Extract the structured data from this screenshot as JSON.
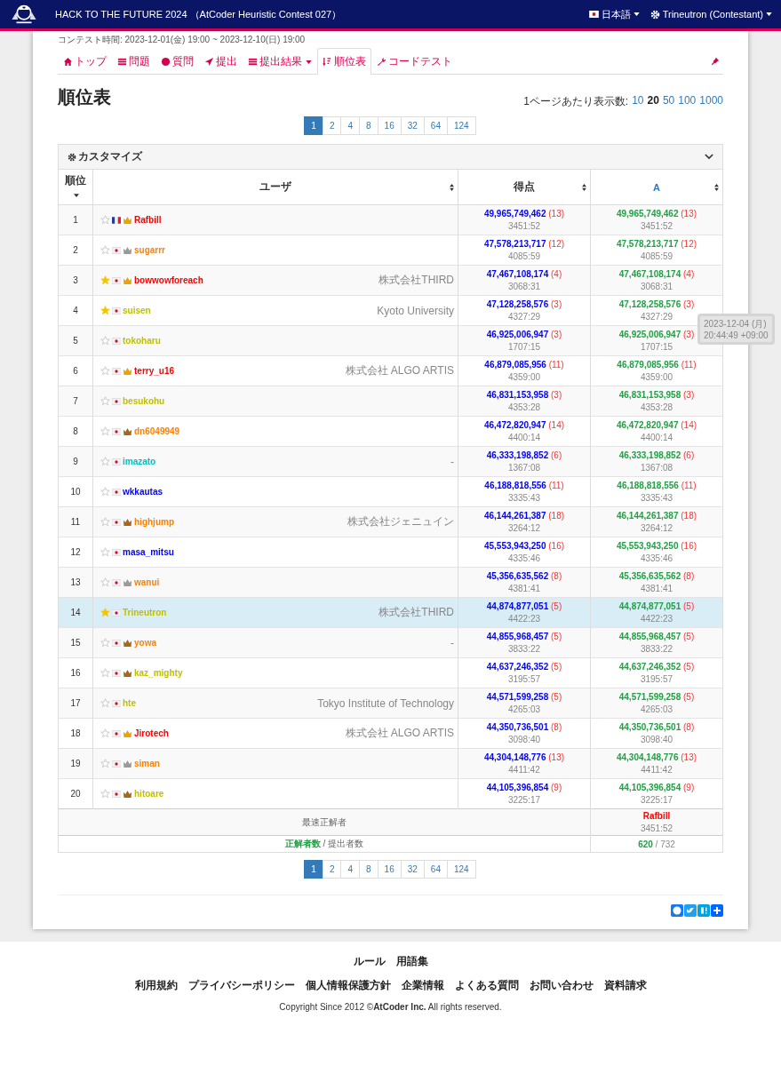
{
  "header": {
    "title": "HACK TO THE FUTURE 2024 （AtCoder Heuristic Contest 027）",
    "language": "日本語",
    "user": "Trineutron (Contestant)"
  },
  "contest_period": "コンテスト時間: 2023-12-01(金) 19:00 ~ 2023-12-10(日) 19:00",
  "tabs": [
    {
      "label": "トップ",
      "selected": false,
      "dropdown": false
    },
    {
      "label": "問題",
      "selected": false,
      "dropdown": false
    },
    {
      "label": "質問",
      "selected": false,
      "dropdown": false
    },
    {
      "label": "提出",
      "selected": false,
      "dropdown": false
    },
    {
      "label": "提出結果",
      "selected": false,
      "dropdown": true
    },
    {
      "label": "順位表",
      "selected": true,
      "dropdown": false
    },
    {
      "label": "コードテスト",
      "selected": false,
      "dropdown": false
    }
  ],
  "page_title": "順位表",
  "per_page": {
    "label": "1ページあたり表示数:",
    "options": [
      {
        "label": "10",
        "selected": false
      },
      {
        "label": "20",
        "selected": true
      },
      {
        "label": "50",
        "selected": false
      },
      {
        "label": "100",
        "selected": false
      },
      {
        "label": "1000",
        "selected": false
      }
    ]
  },
  "pagination_top": [
    {
      "label": "1",
      "selected": true
    },
    {
      "label": "2",
      "selected": false
    },
    {
      "label": "4",
      "selected": false
    },
    {
      "label": "8",
      "selected": false
    },
    {
      "label": "16",
      "selected": false
    },
    {
      "label": "32",
      "selected": false
    },
    {
      "label": "64",
      "selected": false
    },
    {
      "label": "124",
      "selected": false
    }
  ],
  "customize": "カスタマイズ",
  "columns": [
    "順位",
    "ユーザ",
    "得点",
    "A"
  ],
  "rows": [
    {
      "rank": "1",
      "favorite": false,
      "flag": {
        "kind": "fr"
      },
      "crown": {
        "kind": "gold"
      },
      "user": "Rafbill",
      "color": "#ff0000",
      "affiliation": "",
      "score": "49,965,749,462",
      "penalty": "(13)",
      "time": "3451:52",
      "a_score": "49,965,749,462",
      "a_penalty": "(13)",
      "a_time": "3451:52",
      "highlighted": false
    },
    {
      "rank": "2",
      "favorite": false,
      "flag": {
        "kind": "jp"
      },
      "crown": {
        "kind": "silver"
      },
      "user": "sugarrr",
      "color": "#ff8000",
      "affiliation": "",
      "score": "47,578,213,717",
      "penalty": "(12)",
      "time": "4085:59",
      "a_score": "47,578,213,717",
      "a_penalty": "(12)",
      "a_time": "4085:59",
      "highlighted": false
    },
    {
      "rank": "3",
      "favorite": true,
      "flag": {
        "kind": "jp"
      },
      "crown": {
        "kind": "gold"
      },
      "user": "bowwowforeach",
      "color": "#ff0000",
      "affiliation": "株式会社THIRD",
      "score": "47,467,108,174",
      "penalty": "(4)",
      "time": "3068:31",
      "a_score": "47,467,108,174",
      "a_penalty": "(4)",
      "a_time": "3068:31",
      "highlighted": false
    },
    {
      "rank": "4",
      "favorite": true,
      "flag": {
        "kind": "jp"
      },
      "user": "suisen",
      "color": "#c0c000",
      "affiliation": "Kyoto University",
      "score": "47,128,258,576",
      "penalty": "(3)",
      "time": "4327:29",
      "a_score": "47,128,258,576",
      "a_penalty": "(3)",
      "a_time": "4327:29",
      "highlighted": false
    },
    {
      "rank": "5",
      "favorite": false,
      "flag": {
        "kind": "jp"
      },
      "user": "tokoharu",
      "color": "#c0c000",
      "affiliation": "",
      "score": "46,925,006,947",
      "penalty": "(3)",
      "time": "1707:15",
      "a_score": "46,925,006,947",
      "a_penalty": "(3)",
      "a_time": "1707:15",
      "highlighted": false
    },
    {
      "rank": "6",
      "favorite": false,
      "flag": {
        "kind": "jp"
      },
      "crown": {
        "kind": "gold"
      },
      "user": "terry_u16",
      "color": "#ff0000",
      "affiliation": "株式会社 ALGO ARTIS",
      "score": "46,879,085,956",
      "penalty": "(11)",
      "time": "4359:00",
      "a_score": "46,879,085,956",
      "a_penalty": "(11)",
      "a_time": "4359:00",
      "highlighted": false
    },
    {
      "rank": "7",
      "favorite": false,
      "flag": {
        "kind": "jp"
      },
      "user": "besukohu",
      "color": "#c0c000",
      "affiliation": "",
      "score": "46,831,153,958",
      "penalty": "(3)",
      "time": "4353:28",
      "a_score": "46,831,153,958",
      "a_penalty": "(3)",
      "a_time": "4353:28",
      "highlighted": false
    },
    {
      "rank": "8",
      "favorite": false,
      "flag": {
        "kind": "jp"
      },
      "crown": {
        "kind": "bronze"
      },
      "user": "dn6049949",
      "color": "#ff8000",
      "affiliation": "",
      "score": "46,472,820,947",
      "penalty": "(14)",
      "time": "4400:14",
      "a_score": "46,472,820,947",
      "a_penalty": "(14)",
      "a_time": "4400:14",
      "highlighted": false
    },
    {
      "rank": "9",
      "favorite": false,
      "flag": {
        "kind": "jp"
      },
      "user": "imazato",
      "color": "#00c0c0",
      "affiliation": "-",
      "score": "46,333,198,852",
      "penalty": "(6)",
      "time": "1367:08",
      "a_score": "46,333,198,852",
      "a_penalty": "(6)",
      "a_time": "1367:08",
      "highlighted": false
    },
    {
      "rank": "10",
      "favorite": false,
      "flag": {
        "kind": "jp"
      },
      "user": "wkkautas",
      "color": "#0000ff",
      "affiliation": "",
      "score": "46,188,818,556",
      "penalty": "(11)",
      "time": "3335:43",
      "a_score": "46,188,818,556",
      "a_penalty": "(11)",
      "a_time": "3335:43",
      "highlighted": false
    },
    {
      "rank": "11",
      "favorite": false,
      "flag": {
        "kind": "jp"
      },
      "crown": {
        "kind": "bronze"
      },
      "user": "highjump",
      "color": "#ff8000",
      "affiliation": "株式会社ジェニュイン",
      "score": "46,144,261,387",
      "penalty": "(18)",
      "time": "3264:12",
      "a_score": "46,144,261,387",
      "a_penalty": "(18)",
      "a_time": "3264:12",
      "highlighted": false
    },
    {
      "rank": "12",
      "favorite": false,
      "flag": {
        "kind": "jp"
      },
      "user": "masa_mitsu",
      "color": "#0000ff",
      "affiliation": "",
      "score": "45,553,943,250",
      "penalty": "(16)",
      "time": "4335:46",
      "a_score": "45,553,943,250",
      "a_penalty": "(16)",
      "a_time": "4335:46",
      "highlighted": false
    },
    {
      "rank": "13",
      "favorite": false,
      "flag": {
        "kind": "jp"
      },
      "crown": {
        "kind": "silver"
      },
      "user": "wanui",
      "color": "#ff8000",
      "affiliation": "",
      "score": "45,356,635,562",
      "penalty": "(8)",
      "time": "4381:41",
      "a_score": "45,356,635,562",
      "a_penalty": "(8)",
      "a_time": "4381:41",
      "highlighted": false
    },
    {
      "rank": "14",
      "favorite": true,
      "flag": {
        "kind": "jp"
      },
      "user": "Trineutron",
      "color": "#c0c000",
      "affiliation": "株式会社THIRD",
      "score": "44,874,877,051",
      "penalty": "(5)",
      "time": "4422:23",
      "a_score": "44,874,877,051",
      "a_penalty": "(5)",
      "a_time": "4422:23",
      "highlighted": true
    },
    {
      "rank": "15",
      "favorite": false,
      "flag": {
        "kind": "jp"
      },
      "crown": {
        "kind": "bronze"
      },
      "user": "yowa",
      "color": "#ff8000",
      "affiliation": "-",
      "score": "44,855,968,457",
      "penalty": "(5)",
      "time": "3833:22",
      "a_score": "44,855,968,457",
      "a_penalty": "(5)",
      "a_time": "3833:22",
      "highlighted": false
    },
    {
      "rank": "16",
      "favorite": false,
      "flag": {
        "kind": "jp"
      },
      "crown": {
        "kind": "bronze"
      },
      "user": "kaz_mighty",
      "color": "#c0c000",
      "affiliation": "",
      "score": "44,637,246,352",
      "penalty": "(5)",
      "time": "3195:57",
      "a_score": "44,637,246,352",
      "a_penalty": "(5)",
      "a_time": "3195:57",
      "highlighted": false
    },
    {
      "rank": "17",
      "favorite": false,
      "flag": {
        "kind": "jp"
      },
      "user": "hte",
      "color": "#c0c000",
      "affiliation": "Tokyo Institute of Technology",
      "score": "44,571,599,258",
      "penalty": "(5)",
      "time": "4265:03",
      "a_score": "44,571,599,258",
      "a_penalty": "(5)",
      "a_time": "4265:03",
      "highlighted": false
    },
    {
      "rank": "18",
      "favorite": false,
      "flag": {
        "kind": "jp"
      },
      "crown": {
        "kind": "gold"
      },
      "user": "Jirotech",
      "color": "#ff0000",
      "affiliation": "株式会社 ALGO ARTIS",
      "score": "44,350,736,501",
      "penalty": "(8)",
      "time": "3098:40",
      "a_score": "44,350,736,501",
      "a_penalty": "(8)",
      "a_time": "3098:40",
      "highlighted": false
    },
    {
      "rank": "19",
      "favorite": false,
      "flag": {
        "kind": "jp"
      },
      "crown": {
        "kind": "silver"
      },
      "user": "siman",
      "color": "#ff8000",
      "affiliation": "",
      "score": "44,304,148,776",
      "penalty": "(13)",
      "time": "4411:42",
      "a_score": "44,304,148,776",
      "a_penalty": "(13)",
      "a_time": "4411:42",
      "highlighted": false
    },
    {
      "rank": "20",
      "favorite": false,
      "flag": {
        "kind": "jp"
      },
      "crown": {
        "kind": "bronze"
      },
      "user": "hitoare",
      "color": "#c0c000",
      "affiliation": "",
      "score": "44,105,396,854",
      "penalty": "(9)",
      "time": "3225:17",
      "a_score": "44,105,396,854",
      "a_penalty": "(9)",
      "a_time": "3225:17",
      "highlighted": false
    }
  ],
  "fastest": {
    "label": "最速正解者",
    "user": "Rafbill",
    "time": "3451:52"
  },
  "solved": {
    "label_solved": "正解者数",
    "label_submitted": "/ 提出者数",
    "solved": "620",
    "submitted": "/ 732"
  },
  "tooltip": [
    "2023-12-04 (月)",
    "20:44:49 +09:00"
  ],
  "pagination_bottom": [
    {
      "label": "1",
      "selected": true
    },
    {
      "label": "2",
      "selected": false
    },
    {
      "label": "4",
      "selected": false
    },
    {
      "label": "8",
      "selected": false
    },
    {
      "label": "16",
      "selected": false
    },
    {
      "label": "32",
      "selected": false
    },
    {
      "label": "64",
      "selected": false
    },
    {
      "label": "124",
      "selected": false
    }
  ],
  "footer": {
    "links_1": [
      "ルール",
      "用語集"
    ],
    "links_2": [
      "利用規約",
      "プライバシーポリシー",
      "個人情報保護方針",
      "企業情報",
      "よくある質問",
      "お問い合わせ",
      "資料請求"
    ],
    "copyright_pre": "Copyright Since 2012 ©",
    "copyright_company": "AtCoder Inc.",
    "copyright_post": " All rights reserved."
  }
}
